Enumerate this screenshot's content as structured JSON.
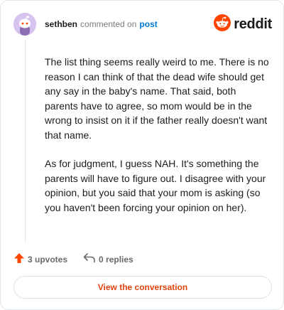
{
  "header": {
    "username": "sethben",
    "verb": "commented on",
    "post_link": "post",
    "avatar_icon": "snoo-avatar-icon",
    "logo_word": "reddit",
    "logo_icon": "reddit-logo-icon",
    "brand_color": "#ff4500"
  },
  "comment": {
    "paragraphs": [
      "The list thing seems really weird to me. There is no reason I can think of that the dead wife should get any say in the baby's name. That said, both parents have to agree, so mom would be in the wrong to insist on it if the father really doesn't want that name.",
      "As for judgment, I guess NAH. It's something the parents will have to figure out. I disagree with your opinion, but you said that your mom is asking (so you haven't been forcing your opinion on her)."
    ]
  },
  "actions": {
    "upvotes": "3 upvotes",
    "replies": "0 replies",
    "upvote_icon": "upvote-arrow-icon",
    "reply_icon": "reply-arrow-icon",
    "upvote_color": "#ff4500"
  },
  "cta": {
    "label": "View the conversation",
    "color": "#e0440e"
  }
}
